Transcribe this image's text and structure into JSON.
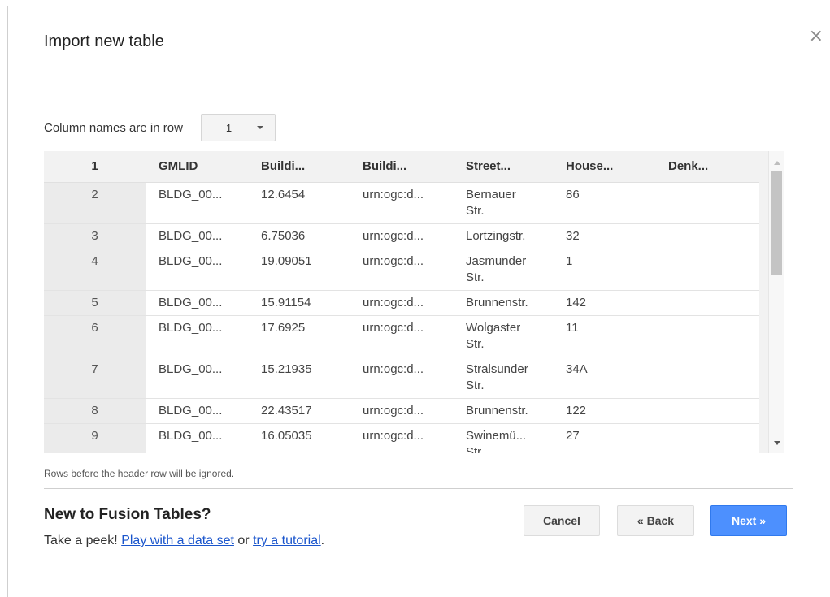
{
  "dialog": {
    "title": "Import new table",
    "close_glyph": "×",
    "close_icon": "close-icon"
  },
  "column_names": {
    "label": "Column names are in row",
    "selected_row": "1"
  },
  "table": {
    "headers": [
      "1",
      "GMLID",
      "Buildi...",
      "Buildi...",
      "Street...",
      "House...",
      "Denk..."
    ],
    "rows": [
      [
        "2",
        "BLDG_00...",
        "12.6454",
        "urn:ogc:d...",
        "Bernauer\nStr.",
        "86",
        ""
      ],
      [
        "3",
        "BLDG_00...",
        "6.75036",
        "urn:ogc:d...",
        "Lortzingstr.",
        "32",
        ""
      ],
      [
        "4",
        "BLDG_00...",
        "19.09051",
        "urn:ogc:d...",
        "Jasmunder\nStr.",
        "1",
        ""
      ],
      [
        "5",
        "BLDG_00...",
        "15.91154",
        "urn:ogc:d...",
        "Brunnenstr.",
        "142",
        ""
      ],
      [
        "6",
        "BLDG_00...",
        "17.6925",
        "urn:ogc:d...",
        "Wolgaster\nStr.",
        "11",
        ""
      ],
      [
        "7",
        "BLDG_00...",
        "15.21935",
        "urn:ogc:d...",
        "Stralsunder\nStr.",
        "34A",
        ""
      ],
      [
        "8",
        "BLDG_00...",
        "22.43517",
        "urn:ogc:d...",
        "Brunnenstr.",
        "122",
        ""
      ],
      [
        "9",
        "BLDG_00...",
        "16.05035",
        "urn:ogc:d...",
        "Swinemü...\nStr.",
        "27",
        ""
      ]
    ]
  },
  "note": "Rows before the header row will be ignored.",
  "footer": {
    "heading": "New to Fusion Tables?",
    "peek_prefix": "Take a peek!",
    "link_dataset": "Play with a data set",
    "or_text": "or",
    "link_tutorial": "try a tutorial",
    "period": "."
  },
  "buttons": {
    "cancel": "Cancel",
    "back": "« Back",
    "next": "Next »"
  },
  "colors": {
    "primary": "#4d90fe",
    "link": "#1a55cc"
  }
}
